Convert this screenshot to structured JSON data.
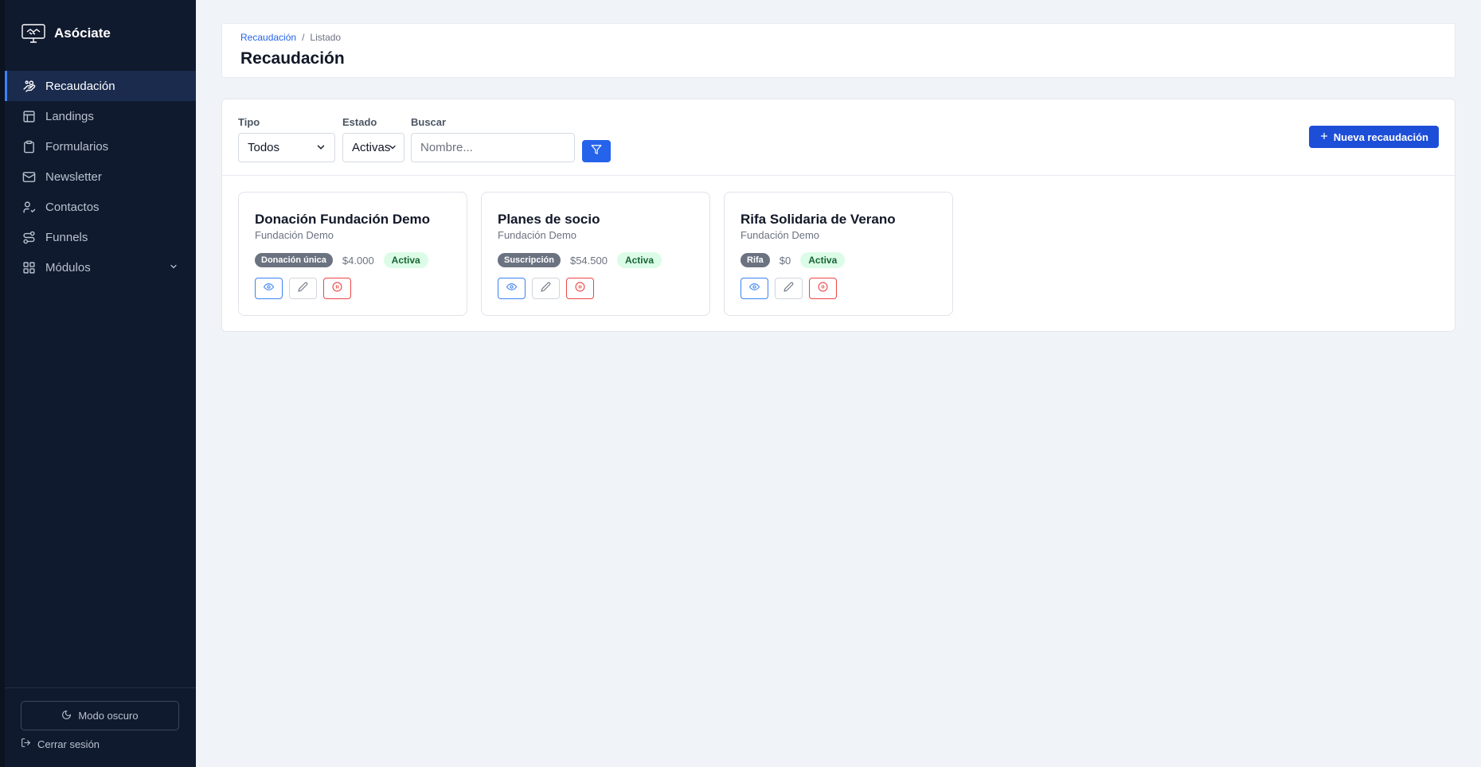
{
  "app": {
    "name": "Asóciate"
  },
  "sidebar": {
    "items": [
      {
        "label": "Recaudación",
        "icon": "hand-coins-icon",
        "active": true
      },
      {
        "label": "Landings",
        "icon": "layout-icon",
        "active": false
      },
      {
        "label": "Formularios",
        "icon": "clipboard-icon",
        "active": false
      },
      {
        "label": "Newsletter",
        "icon": "mail-icon",
        "active": false
      },
      {
        "label": "Contactos",
        "icon": "user-check-icon",
        "active": false
      },
      {
        "label": "Funnels",
        "icon": "route-icon",
        "active": false
      },
      {
        "label": "Módulos",
        "icon": "grid-icon",
        "active": false,
        "expandable": true
      }
    ],
    "dark_mode_label": "Modo oscuro",
    "logout_label": "Cerrar sesión"
  },
  "header": {
    "breadcrumb": {
      "first": "Recaudación",
      "separator": "/",
      "current": "Listado"
    },
    "title": "Recaudación"
  },
  "filters": {
    "type_label": "Tipo",
    "type_value": "Todos",
    "state_label": "Estado",
    "state_value": "Activas",
    "search_label": "Buscar",
    "search_placeholder": "Nombre...",
    "new_button": "Nueva recaudación"
  },
  "cards": [
    {
      "title": "Donación Fundación Demo",
      "org": "Fundación Demo",
      "type": "Donación única",
      "amount": "$4.000",
      "status": "Activa"
    },
    {
      "title": "Planes de socio",
      "org": "Fundación Demo",
      "type": "Suscripción",
      "amount": "$54.500",
      "status": "Activa"
    },
    {
      "title": "Rifa Solidaria de Verano",
      "org": "Fundación Demo",
      "type": "Rifa",
      "amount": "$0",
      "status": "Activa"
    }
  ],
  "colors": {
    "sidebar_bg": "#101a2e",
    "active_bg": "#1a2b4d",
    "accent": "#2563eb",
    "danger": "#ef4444",
    "success_bg": "#dcfce7",
    "success_text": "#166534"
  }
}
